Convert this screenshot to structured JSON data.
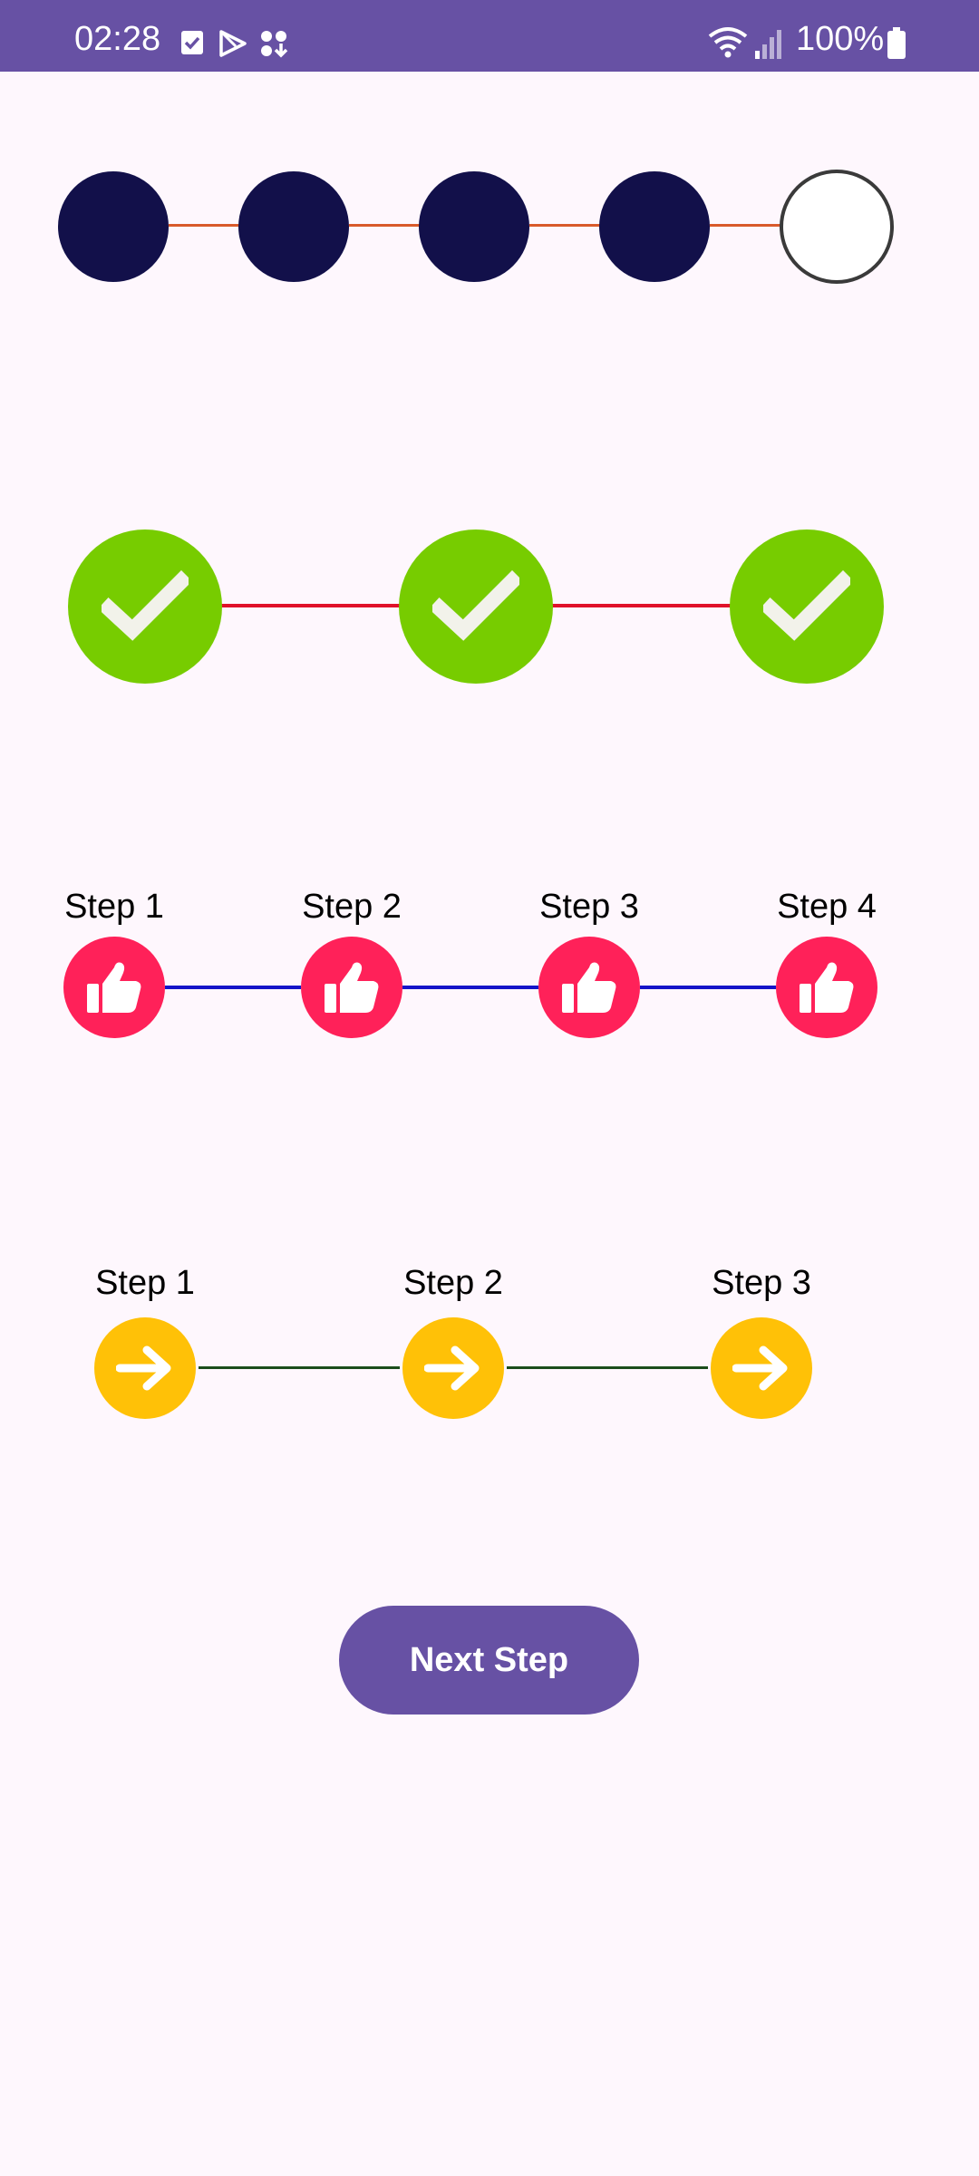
{
  "status_bar": {
    "time": "02:28",
    "battery": "100%",
    "icons": [
      "calendar-check-icon",
      "play-store-icon",
      "apps-download-icon",
      "wifi-icon",
      "signal-icon",
      "battery-icon"
    ]
  },
  "stepper1": {
    "completed_steps": 4,
    "total_steps": 5,
    "colors": {
      "filled": "#12104A",
      "line": "#D95A2B",
      "empty_border": "#3A3A3A"
    }
  },
  "stepper2": {
    "steps": 3,
    "icon": "checkmark-icon",
    "colors": {
      "fill": "#77CC00",
      "line": "#E0122A"
    }
  },
  "stepper3": {
    "labels": [
      "Step 1",
      "Step 2",
      "Step 3",
      "Step 4"
    ],
    "icon": "thumbs-up-icon",
    "colors": {
      "fill": "#FF2159",
      "line": "#1414C8"
    }
  },
  "stepper4": {
    "labels": [
      "Step 1",
      "Step 2",
      "Step 3"
    ],
    "icon": "arrow-right-icon",
    "colors": {
      "fill": "#FFC107",
      "line": "#1B4D1B"
    }
  },
  "next_button": {
    "label": "Next Step",
    "color": "#6751A4"
  }
}
